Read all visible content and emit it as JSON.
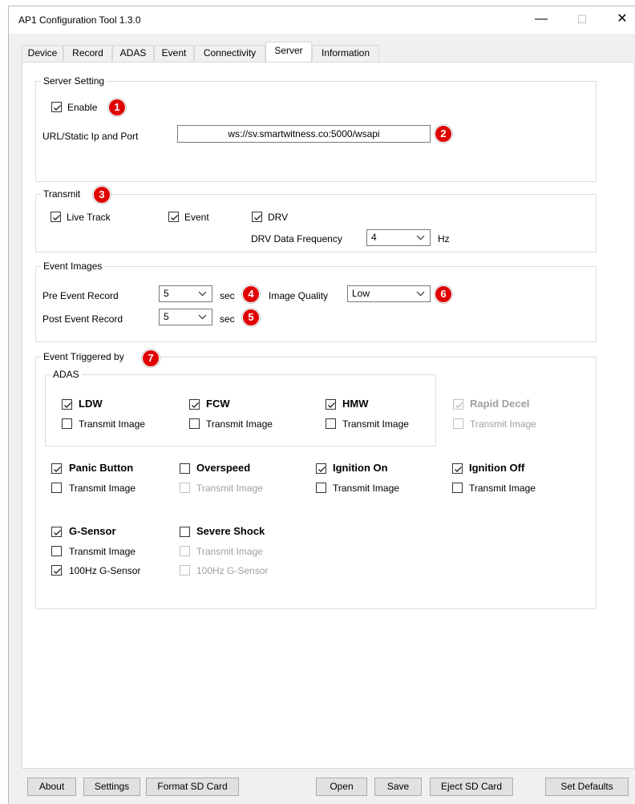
{
  "window": {
    "title": "AP1 Configuration Tool 1.3.0",
    "minimize_icon": "minimize-icon",
    "maximize_icon": "maximize-icon",
    "close_icon": "close-icon"
  },
  "tabs": [
    {
      "label": "Device"
    },
    {
      "label": "Record"
    },
    {
      "label": "ADAS"
    },
    {
      "label": "Event"
    },
    {
      "label": "Connectivity"
    },
    {
      "label": "Server",
      "active": true
    },
    {
      "label": "Information"
    }
  ],
  "server_setting": {
    "title": "Server Setting",
    "enable_label": "Enable",
    "enable_checked": true,
    "url_label": "URL/Static Ip and Port",
    "url_value": "ws://sv.smartwitness.co:5000/wsapi"
  },
  "transmit": {
    "title": "Transmit",
    "live_track": {
      "label": "Live Track",
      "checked": true
    },
    "event": {
      "label": "Event",
      "checked": true
    },
    "drv": {
      "label": "DRV",
      "checked": true
    },
    "drv_freq_label": "DRV Data Frequency",
    "drv_freq_value": "4",
    "drv_freq_unit": "Hz"
  },
  "event_images": {
    "title": "Event Images",
    "pre_label": "Pre Event Record",
    "pre_value": "5",
    "pre_unit": "sec",
    "post_label": "Post Event Record",
    "post_value": "5",
    "post_unit": "sec",
    "quality_label": "Image Quality",
    "quality_value": "Low"
  },
  "event_triggered": {
    "title": "Event Triggered by",
    "adas_title": "ADAS",
    "ldw": {
      "label": "LDW",
      "checked": true,
      "transmit": "Transmit Image",
      "transmit_checked": false
    },
    "fcw": {
      "label": "FCW",
      "checked": true,
      "transmit": "Transmit Image",
      "transmit_checked": false
    },
    "hmw": {
      "label": "HMW",
      "checked": true,
      "transmit": "Transmit Image",
      "transmit_checked": false
    },
    "rapid_decel": {
      "label": "Rapid Decel",
      "checked": true,
      "disabled": true,
      "transmit": "Transmit Image",
      "transmit_checked": false
    },
    "panic": {
      "label": "Panic Button",
      "checked": true,
      "transmit": "Transmit Image",
      "transmit_checked": false
    },
    "overspeed": {
      "label": "Overspeed",
      "checked": false,
      "transmit": "Transmit Image",
      "transmit_checked": false,
      "transmit_disabled": true
    },
    "ign_on": {
      "label": "Ignition On",
      "checked": true,
      "transmit": "Transmit Image",
      "transmit_checked": false
    },
    "ign_off": {
      "label": "Ignition Off",
      "checked": true,
      "transmit": "Transmit Image",
      "transmit_checked": false
    },
    "gsensor": {
      "label": "G-Sensor",
      "checked": true,
      "transmit": "Transmit Image",
      "transmit_checked": false,
      "hz": "100Hz G-Sensor",
      "hz_checked": true
    },
    "severe": {
      "label": "Severe Shock",
      "checked": false,
      "transmit": "Transmit Image",
      "transmit_checked": false,
      "transmit_disabled": true,
      "hz": "100Hz G-Sensor",
      "hz_checked": false,
      "hz_disabled": true
    }
  },
  "badges": [
    "1",
    "2",
    "3",
    "4",
    "5",
    "6",
    "7"
  ],
  "buttons": {
    "about": "About",
    "settings": "Settings",
    "format": "Format SD Card",
    "open": "Open",
    "save": "Save",
    "eject": "Eject SD Card",
    "defaults": "Set Defaults"
  },
  "colors": {
    "badge": "#e00000",
    "panel": "#ffffff",
    "window": "#f0f0f0"
  }
}
